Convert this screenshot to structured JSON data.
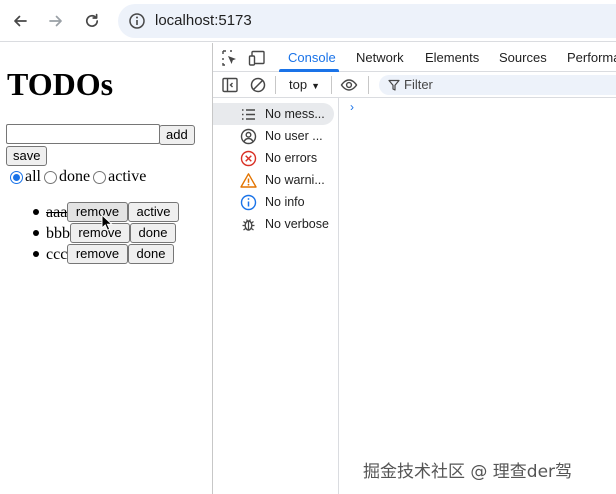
{
  "browser": {
    "url": "localhost:5173"
  },
  "page": {
    "title": "TODOs",
    "input_value": "",
    "add_label": "add",
    "save_label": "save",
    "filters": [
      {
        "label": "all",
        "checked": true
      },
      {
        "label": "done",
        "checked": false
      },
      {
        "label": "active",
        "checked": false
      }
    ],
    "todos": [
      {
        "text": "aaa",
        "done": true,
        "remove_label": "remove",
        "toggle_label": "active"
      },
      {
        "text": "bbb",
        "done": false,
        "remove_label": "remove",
        "toggle_label": "done"
      },
      {
        "text": "ccc",
        "done": false,
        "remove_label": "remove",
        "toggle_label": "done"
      }
    ]
  },
  "devtools": {
    "tabs": [
      "Console",
      "Network",
      "Elements",
      "Sources",
      "Performa"
    ],
    "active_tab": "Console",
    "context": "top",
    "filter_placeholder": "Filter",
    "sidebar": [
      {
        "label": "No mess...",
        "icon": "list-icon"
      },
      {
        "label": "No user ...",
        "icon": "user-icon"
      },
      {
        "label": "No errors",
        "icon": "error-icon"
      },
      {
        "label": "No warni...",
        "icon": "warning-icon"
      },
      {
        "label": "No info",
        "icon": "info-icon"
      },
      {
        "label": "No verbose",
        "icon": "bug-icon"
      }
    ],
    "prompt_symbol": "›"
  },
  "watermark": "掘金技术社区 @ 理查der驾",
  "colors": {
    "accent": "#1a73e8",
    "error": "#d93025",
    "warning": "#e37400"
  }
}
